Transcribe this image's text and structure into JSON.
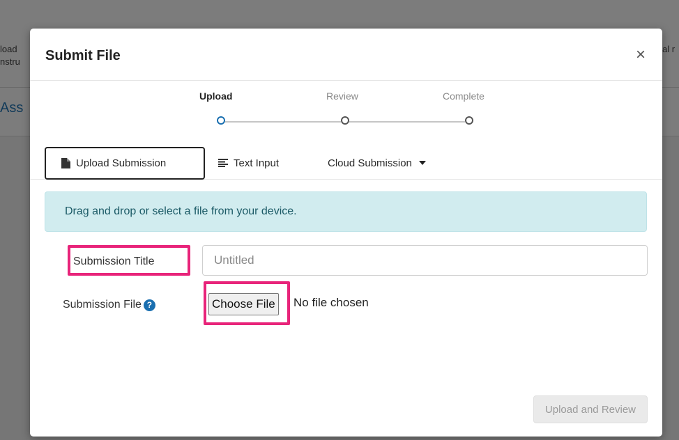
{
  "background": {
    "left_line_1": "load",
    "left_line_2": "nstru",
    "right_line_1": "al r",
    "heading": "Ass"
  },
  "modal": {
    "title": "Submit File",
    "close_symbol": "×"
  },
  "stepper": {
    "steps": [
      {
        "label": "Upload",
        "state": "active"
      },
      {
        "label": "Review",
        "state": "inactive"
      },
      {
        "label": "Complete",
        "state": "inactive"
      }
    ]
  },
  "tabs": [
    {
      "label": "Upload Submission",
      "icon": "file-icon",
      "active": true
    },
    {
      "label": "Text Input",
      "icon": "align-left-icon",
      "active": false
    },
    {
      "label": "Cloud Submission",
      "icon": "caret-down-icon",
      "active": false
    }
  ],
  "alert": {
    "text": "Drag and drop or select a file from your device."
  },
  "form": {
    "title_label": "Submission Title",
    "title_placeholder": "Untitled",
    "title_value": "",
    "file_label": "Submission File",
    "help_symbol": "?",
    "choose_file_label": "Choose File",
    "no_file_text": "No file chosen"
  },
  "actions": {
    "upload_review_label": "Upload and Review"
  },
  "colors": {
    "accent": "#1a6fb0",
    "highlight": "#e8247a",
    "alert_bg": "#d1ecef"
  }
}
